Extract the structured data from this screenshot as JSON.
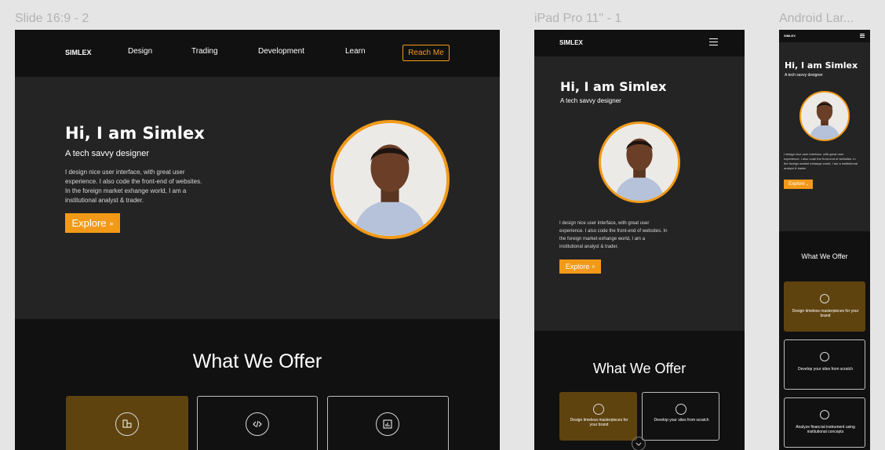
{
  "frames": {
    "desktop": {
      "label": "Slide 16:9 - 2"
    },
    "tablet": {
      "label": "iPad Pro 11\" - 1"
    },
    "mobile": {
      "label": "Android Lar..."
    }
  },
  "brand": "SIMLEX",
  "nav": {
    "items": [
      "Design",
      "Trading",
      "Development",
      "Learn"
    ],
    "cta": "Reach Me"
  },
  "hero": {
    "title": "Hi, I am Simlex",
    "subtitle": "A tech savvy designer",
    "description": "I design nice user interface, with great user experience. I also code the front-end of websites. In the foreign market exhange world, I am a institutional analyst & trader.",
    "button": "Explore",
    "button_arrow": "»"
  },
  "offer": {
    "title": "What We Offer",
    "cards": [
      {
        "text": "Design timeless masterpieces for your brand",
        "icon": "design-icon"
      },
      {
        "text": "Develop your sites from scratch",
        "icon": "code-icon"
      },
      {
        "text": "Analyze financial instrument using institutional concepts",
        "icon": "chart-icon"
      }
    ]
  },
  "colors": {
    "accent": "#f29a18",
    "dark": "#111111",
    "hero": "#242424",
    "card_active": "#5f430f"
  }
}
